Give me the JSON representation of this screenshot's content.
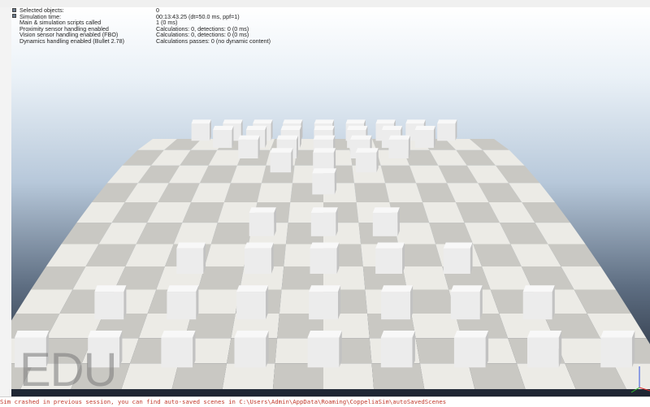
{
  "info_panel": {
    "rows": [
      {
        "label": "Selected objects:",
        "value": "0"
      },
      {
        "label": "Simulation time:",
        "value": "00:13:43.25 (dt=50.0 ms, ppf=1)"
      },
      {
        "label": "Main & simulation scripts called",
        "value": "1 (0 ms)"
      },
      {
        "label": "Proximity sensor handling enabled",
        "value": "Calculations: 0, detections: 0 (0 ms)"
      },
      {
        "label": "Vision sensor handling enabled (FBO)",
        "value": "Calculations: 0, detections: 0 (0 ms)"
      },
      {
        "label": "Dynamics handling enabled (Bullet 2.78)",
        "value": "Calculations passes: 0 (no dynamic content)"
      }
    ]
  },
  "watermark": "EDU",
  "status_message": "Sim crashed in previous session, you can find auto-saved scenes in C:\\Users\\Admin\\AppData\\Roaming\\CoppeliaSim\\autoSavedScenes",
  "scene": {
    "floor": "checkered-floor",
    "cube_rows": [
      {
        "depth": 0.02,
        "xs": [
          -0.82,
          -0.61,
          -0.41,
          -0.21,
          0.0,
          0.21,
          0.41,
          0.61,
          0.82
        ]
      },
      {
        "depth": 0.07,
        "xs": [
          -0.64,
          -0.43,
          -0.21,
          0.0,
          0.21,
          0.43,
          0.64
        ]
      },
      {
        "depth": 0.13,
        "xs": [
          -0.45,
          -0.22,
          0.0,
          0.22,
          0.45
        ]
      },
      {
        "depth": 0.2,
        "xs": [
          -0.24,
          0.0,
          0.24
        ]
      },
      {
        "depth": 0.3,
        "xs": [
          0.0
        ]
      },
      {
        "depth": 0.47,
        "xs": [
          -0.28,
          0.0,
          0.28
        ]
      },
      {
        "depth": 0.61,
        "xs": [
          -0.55,
          -0.27,
          0.0,
          0.27,
          0.55
        ]
      },
      {
        "depth": 0.77,
        "xs": [
          -0.8,
          -0.53,
          -0.27,
          0.0,
          0.27,
          0.53,
          0.8
        ]
      },
      {
        "depth": 0.93,
        "xs": [
          -1.0,
          -0.75,
          -0.5,
          -0.25,
          0.0,
          0.25,
          0.5,
          0.75,
          1.0
        ]
      }
    ]
  },
  "colors": {
    "tile_light": "#ecebe6",
    "tile_dark": "#c9c8c3",
    "cube_front": "#ececec",
    "cube_top": "#f8f8f8",
    "cube_side": "#c2c2c2",
    "axis_x": "#e03030",
    "axis_y": "#30c030",
    "axis_z": "#3050e0"
  }
}
